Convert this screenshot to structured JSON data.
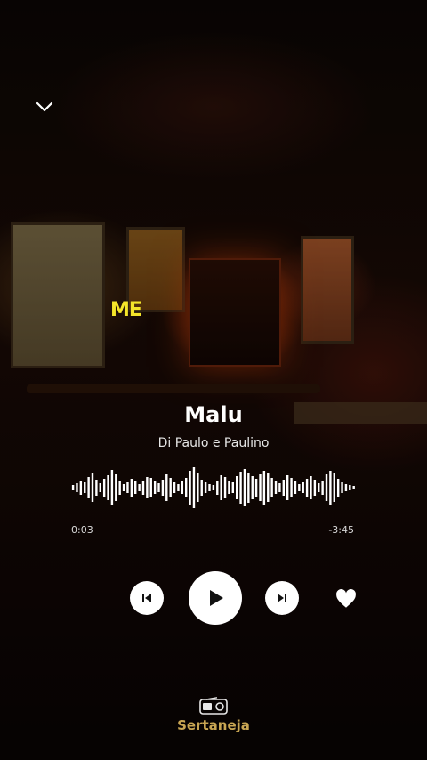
{
  "player": {
    "overlay_badge": "ME",
    "track": {
      "title": "Malu",
      "artist": "Di Paulo e Paulino"
    },
    "progress": {
      "elapsed": "0:03",
      "remaining": "-3:45"
    },
    "station": {
      "name": "Sertaneja",
      "icon": "radio-icon"
    },
    "controls": {
      "collapse_icon": "chevron-down-icon",
      "prev_icon": "skip-previous-icon",
      "play_icon": "play-icon",
      "next_icon": "skip-next-icon",
      "like_icon": "heart-icon"
    }
  },
  "colors": {
    "accent_gold": "#c8a653",
    "badge_yellow": "#f5e62a",
    "text_white": "#ffffff",
    "waveform": "#ffffff"
  }
}
